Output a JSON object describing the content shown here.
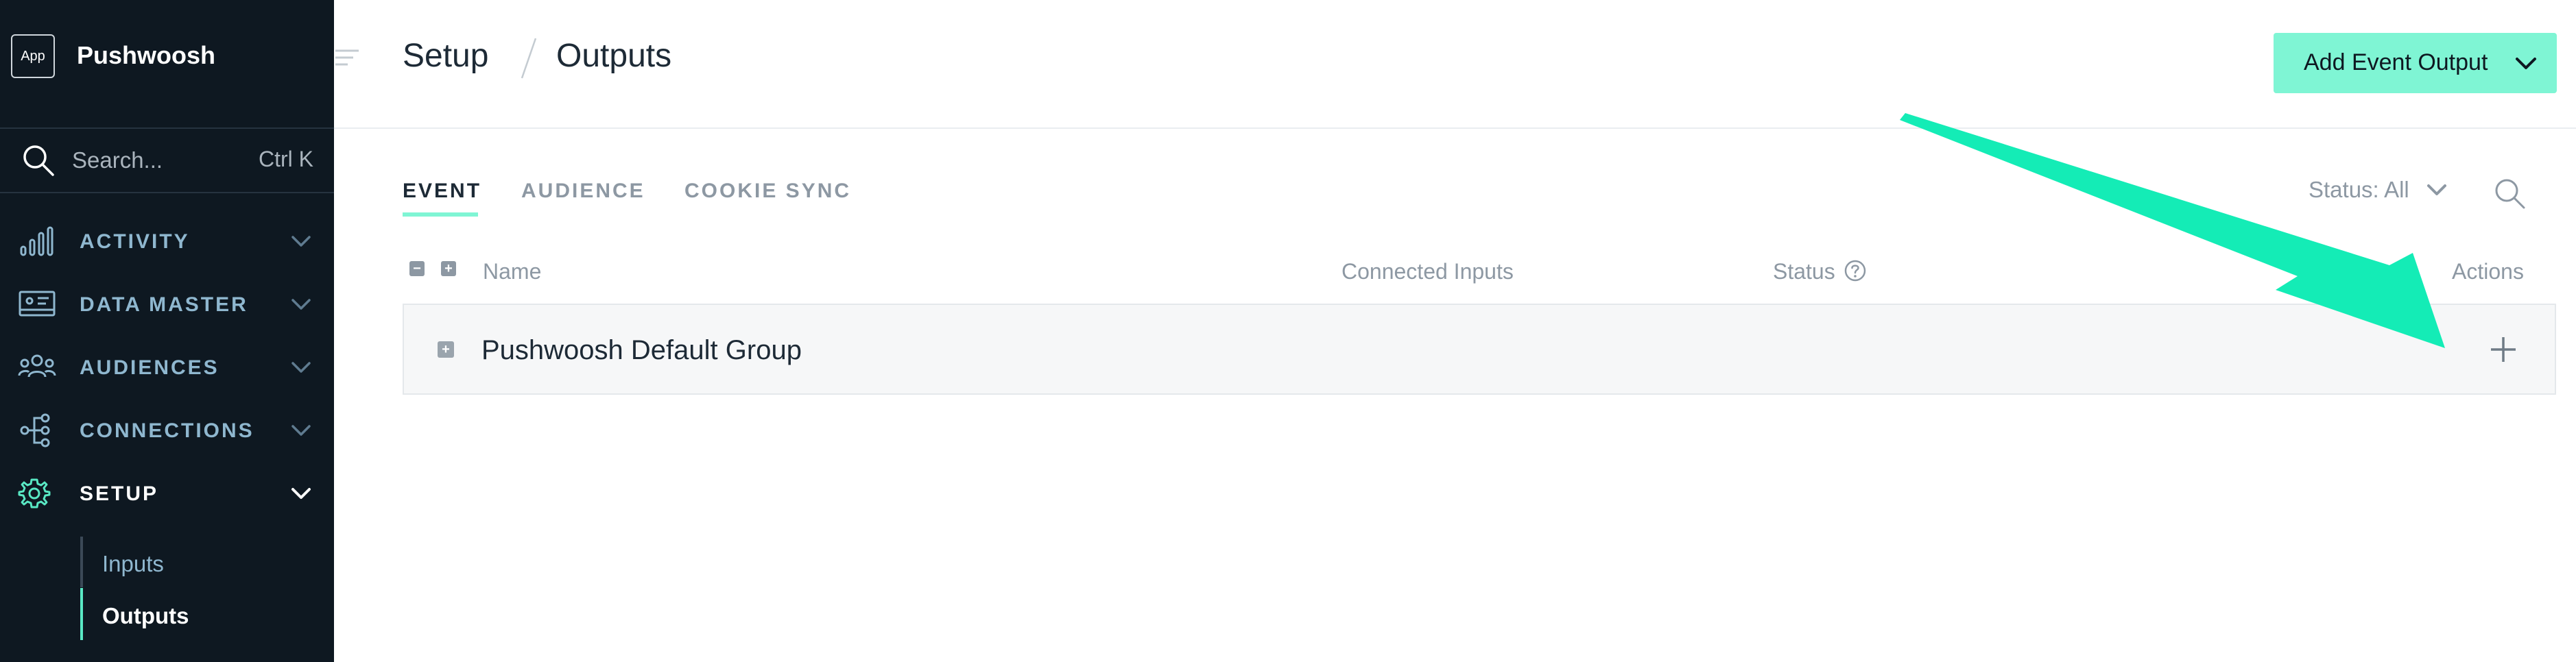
{
  "sidebar": {
    "app_badge": "App",
    "brand_name": "Pushwoosh",
    "search": {
      "placeholder": "Search...",
      "shortcut": "Ctrl K",
      "icon": "search-icon"
    },
    "nav": [
      {
        "label": "ACTIVITY",
        "icon": "activity-bars-icon",
        "expanded": false
      },
      {
        "label": "DATA MASTER",
        "icon": "data-master-icon",
        "expanded": false
      },
      {
        "label": "AUDIENCES",
        "icon": "audiences-icon",
        "expanded": false
      },
      {
        "label": "CONNECTIONS",
        "icon": "connections-icon",
        "expanded": false
      },
      {
        "label": "SETUP",
        "icon": "gear-icon",
        "expanded": true
      }
    ],
    "setup_sub": [
      {
        "label": "Inputs",
        "active": false
      },
      {
        "label": "Outputs",
        "active": true
      }
    ]
  },
  "header": {
    "breadcrumb_parent": "Setup",
    "breadcrumb_current": "Outputs",
    "add_button": "Add Event Output"
  },
  "tabs": [
    {
      "label": "EVENT",
      "active": true
    },
    {
      "label": "AUDIENCE",
      "active": false
    },
    {
      "label": "COOKIE SYNC",
      "active": false
    }
  ],
  "status_filter": "Status: All",
  "table": {
    "columns": [
      "Name",
      "Connected Inputs",
      "Status",
      "Actions"
    ],
    "groups": [
      {
        "name": "Pushwoosh Default Group"
      }
    ]
  },
  "colors": {
    "sidebar_bg": "#0e1821",
    "accent": "#7ff5d4",
    "nav_label": "#8fb7cf",
    "annotation_arrow": "#14ecb6"
  }
}
